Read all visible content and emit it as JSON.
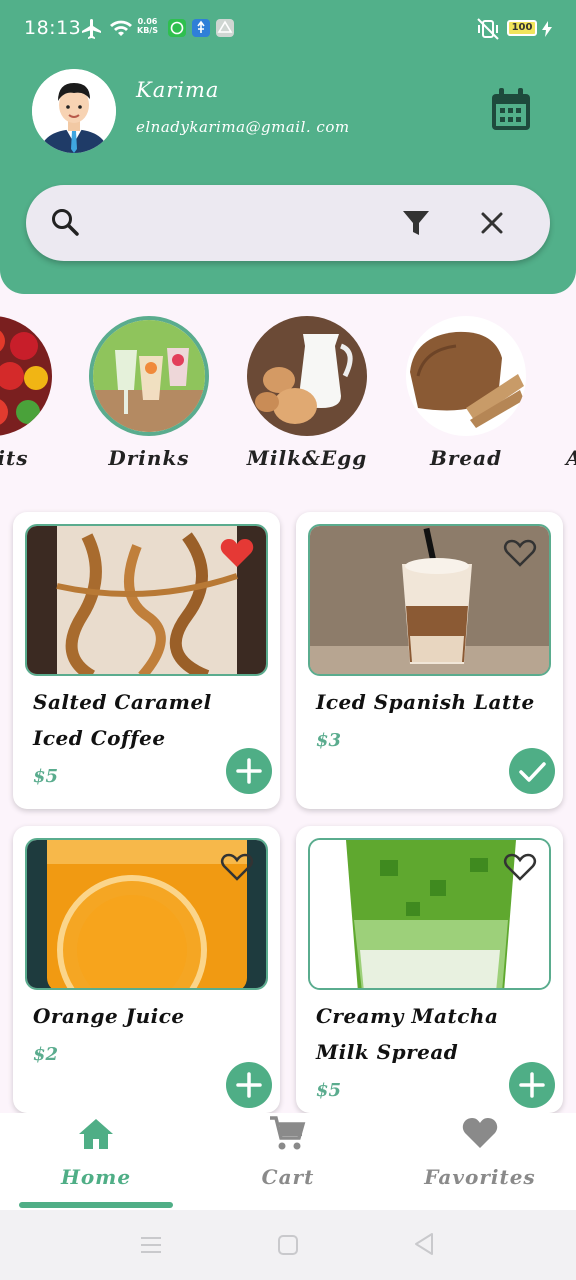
{
  "status_bar": {
    "time": "18:13",
    "net_speed_value": "0.06",
    "net_speed_unit": "KB/S",
    "battery": "100",
    "icons": [
      "airplane-icon",
      "wifi-icon",
      "whatsapp-icon",
      "usb-icon",
      "drive-icon",
      "vibrate-icon",
      "charging-icon"
    ]
  },
  "profile": {
    "name": "Karima",
    "email": "elnadykarima@gmail. com"
  },
  "search": {
    "placeholder": "",
    "icons": [
      "search-icon",
      "filter-icon",
      "clear-icon"
    ]
  },
  "categories": [
    {
      "label": "Fruits",
      "selected": false
    },
    {
      "label": "Drinks",
      "selected": true
    },
    {
      "label": "Milk&Egg",
      "selected": false
    },
    {
      "label": "Bread",
      "selected": false
    },
    {
      "label": "A",
      "selected": false
    }
  ],
  "products": [
    {
      "name": "Salted Caramel Iced Coffee",
      "price": "$5",
      "favorite": true,
      "in_cart": false
    },
    {
      "name": "Iced Spanish Latte",
      "price": "$3",
      "favorite": false,
      "in_cart": true
    },
    {
      "name": "Orange Juice",
      "price": "$2",
      "favorite": false,
      "in_cart": false
    },
    {
      "name": "Creamy Matcha Milk Spread",
      "price": "$5",
      "favorite": false,
      "in_cart": false
    }
  ],
  "bottom_nav": {
    "items": [
      {
        "label": "Home",
        "icon": "home-icon",
        "active": true
      },
      {
        "label": "Cart",
        "icon": "cart-icon",
        "active": false
      },
      {
        "label": "Favorites",
        "icon": "heart-icon",
        "active": false
      }
    ]
  },
  "colors": {
    "primary": "#52b08a",
    "favorite": "#e53935",
    "background": "#fcf4fb",
    "inactive_nav": "#8a8a8a"
  }
}
